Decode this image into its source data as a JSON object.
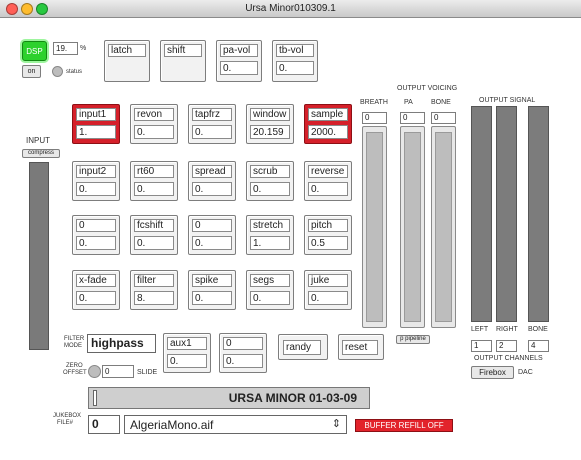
{
  "window": {
    "title": "Ursa Minor010309.1",
    "lights": [
      "#ff5f57",
      "#febc2e",
      "#28c840"
    ]
  },
  "colors": {
    "accent_red": "#d5202a",
    "dsp_green": "#2dd12d",
    "buffer_red": "#e2232b",
    "control_gray": "#f2f2f2"
  },
  "dsp": {
    "label": "DSP",
    "cpu": "19.",
    "cpu_unit": "%",
    "on_label": "on",
    "status_label": "status"
  },
  "toggles": [
    {
      "label": "latch",
      "value": ""
    },
    {
      "label": "shift",
      "value": ""
    },
    {
      "label": "pa-vol",
      "value": "0."
    },
    {
      "label": "tb-vol",
      "value": "0."
    }
  ],
  "input": {
    "label": "INPUT",
    "compress_label": "compress"
  },
  "grid": [
    [
      {
        "label": "input1",
        "value": "1.",
        "active": true
      },
      {
        "label": "revon",
        "value": "0."
      },
      {
        "label": "tapfrz",
        "value": "0."
      },
      {
        "label": "window",
        "value": "20.159"
      },
      {
        "label": "sample",
        "value": "2000.",
        "active": true
      }
    ],
    [
      {
        "label": "input2",
        "value": "0."
      },
      {
        "label": "rt60",
        "value": "0."
      },
      {
        "label": "spread",
        "value": "0."
      },
      {
        "label": "scrub",
        "value": "0."
      },
      {
        "label": "reverse",
        "value": "0."
      }
    ],
    [
      {
        "label": "0",
        "value": "0."
      },
      {
        "label": "fcshift",
        "value": "0."
      },
      {
        "label": "0",
        "value": "0."
      },
      {
        "label": "stretch",
        "value": "1."
      },
      {
        "label": "pitch",
        "value": "0.5"
      }
    ],
    [
      {
        "label": "x-fade",
        "value": "0."
      },
      {
        "label": "filter",
        "value": "8."
      },
      {
        "label": "spike",
        "value": "0."
      },
      {
        "label": "segs",
        "value": "0."
      },
      {
        "label": "juke",
        "value": "0."
      }
    ]
  ],
  "voicing": {
    "heading": "OUTPUT VOICING",
    "breath_label": "BREATH",
    "pa_label": "PA",
    "bone_label": "BONE",
    "breath_value": "0",
    "pa_value": "0",
    "bone_value": "0",
    "pipeline_label": "p pipeline"
  },
  "output_signal": {
    "heading": "OUTPUT SIGNAL",
    "left_label": "LEFT",
    "right_label": "RIGHT",
    "bone_label": "BONE",
    "channels": [
      "1",
      "2",
      "4"
    ],
    "channels_label": "OUTPUT CHANNELS",
    "device": "Firebox",
    "dac_label": "DAC"
  },
  "filter": {
    "mode_label_1": "FILTER",
    "mode_label_2": "MODE",
    "mode_value": "highpass"
  },
  "aux": [
    {
      "label": "aux1",
      "value": "0."
    },
    {
      "label": "0",
      "value": "0."
    }
  ],
  "buttons": {
    "randy": "randy",
    "reset": "reset"
  },
  "zero_offset": {
    "label_1": "ZERO",
    "label_2": "OFFSET",
    "value": "0",
    "slide_label": "SLIDE"
  },
  "banner": "URSA MINOR 01-03-09",
  "jukebox": {
    "label_1": "JUKEBOX",
    "label_2": "FILE#",
    "index": "0",
    "file": "AlgeriaMono.aif",
    "buffer_status": "BUFFER REFILL OFF"
  }
}
